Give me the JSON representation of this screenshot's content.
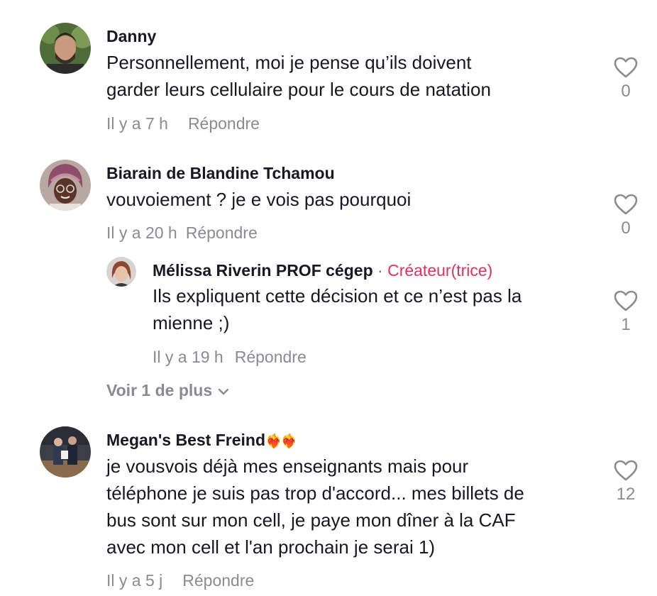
{
  "comments": [
    {
      "author": "Danny",
      "text_lines": [
        "Personnellement, moi je pense qu’ils doivent",
        "garder leurs cellulaire pour le cours de natation"
      ],
      "time": "Il y a 7 h",
      "reply_label": "Répondre",
      "likes": "0",
      "like_icon": "heart-outline-icon"
    },
    {
      "author": "Biarain de Blandine Tchamou",
      "text_lines": [
        "vouvoiement ? je e vois pas pourquoi"
      ],
      "time": "Il y a 20 h",
      "reply_label": "Répondre",
      "likes": "0",
      "like_icon": "heart-outline-icon",
      "replies": [
        {
          "author": "Mélissa Riverin PROF cégep",
          "separator": "·",
          "creator_badge": "Créateur(trice)",
          "text_lines": [
            "Ils expliquent cette décision et ce n’est pas la",
            "mienne ;)"
          ],
          "time": "Il y a 19 h",
          "reply_label": "Répondre",
          "likes": "1",
          "like_icon": "heart-outline-icon"
        }
      ],
      "more_replies_label": "Voir 1 de plus"
    },
    {
      "author": "Megan's Best Freind",
      "author_emoji": "❤️‍🔥❤️‍🔥",
      "text_lines": [
        "je vousvois déjà mes enseignants mais pour",
        "téléphone je suis pas trop d'accord... mes billets de",
        "bus sont sur mon cell, je paye mon dîner à la CAF",
        "avec mon cell et l'an prochain je serai 1)"
      ],
      "time": "Il y a 5 j",
      "reply_label": "Répondre",
      "likes": "12",
      "like_icon": "heart-outline-icon"
    }
  ],
  "colors": {
    "text": "#161823",
    "muted": "#8a8b91",
    "creator": "#e0325f"
  }
}
